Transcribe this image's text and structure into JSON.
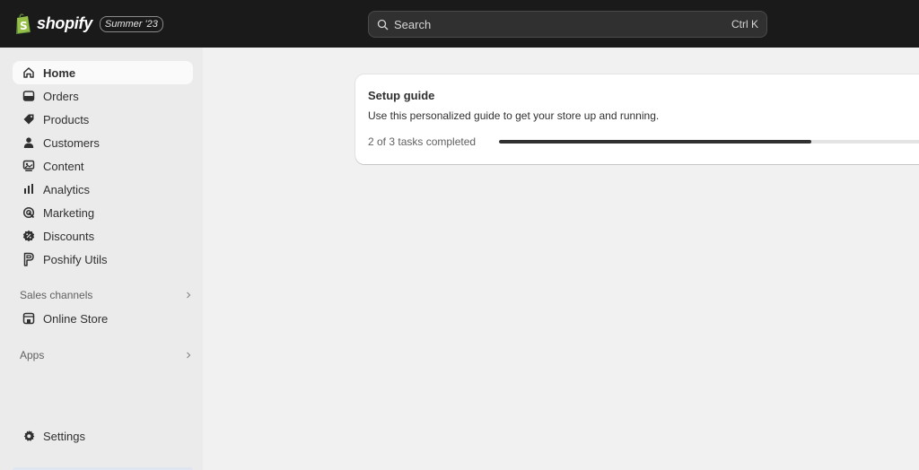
{
  "topbar": {
    "brand": "shopify",
    "edition_badge": "Summer '23",
    "search": {
      "placeholder": "Search",
      "shortcut": "Ctrl K"
    }
  },
  "sidebar": {
    "items": [
      {
        "label": "Home",
        "icon": "home-icon",
        "active": true
      },
      {
        "label": "Orders",
        "icon": "orders-icon",
        "active": false
      },
      {
        "label": "Products",
        "icon": "tag-icon",
        "active": false
      },
      {
        "label": "Customers",
        "icon": "person-icon",
        "active": false
      },
      {
        "label": "Content",
        "icon": "content-icon",
        "active": false
      },
      {
        "label": "Analytics",
        "icon": "bar-chart-icon",
        "active": false
      },
      {
        "label": "Marketing",
        "icon": "target-icon",
        "active": false
      },
      {
        "label": "Discounts",
        "icon": "discount-icon",
        "active": false
      },
      {
        "label": "Poshify Utils",
        "icon": "poshify-p-icon",
        "active": false
      }
    ],
    "sales_channels": {
      "label": "Sales channels",
      "items": [
        {
          "label": "Online Store",
          "icon": "store-icon"
        }
      ]
    },
    "apps": {
      "label": "Apps"
    },
    "settings": {
      "label": "Settings",
      "icon": "gear-icon"
    }
  },
  "setup_guide": {
    "title": "Setup guide",
    "description": "Use this personalized guide to get your store up and running.",
    "progress_text": "2 of 3 tasks completed",
    "completed": 2,
    "total": 3,
    "progress_fraction": 0.74
  },
  "colors": {
    "topbar_bg": "#1a1a1a",
    "sidebar_bg": "#ebebeb",
    "main_bg": "#f1f1f1",
    "brand_green": "#95bf47",
    "progress_fill": "#303030"
  }
}
